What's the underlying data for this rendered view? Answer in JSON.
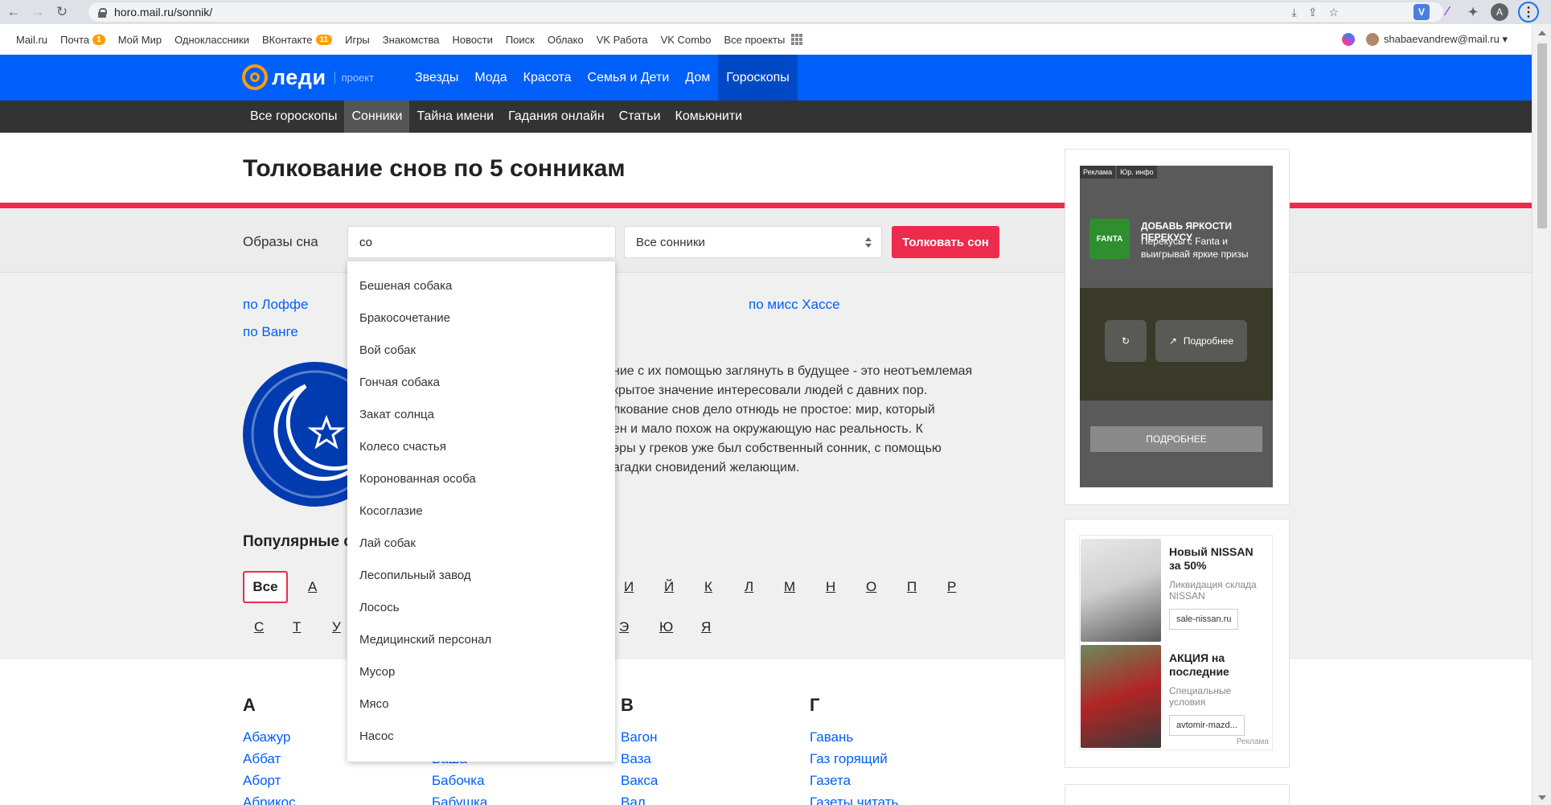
{
  "browser": {
    "url": "horo.mail.ru/sonnik/"
  },
  "portal": {
    "links": [
      {
        "label": "Mail.ru",
        "badge": ""
      },
      {
        "label": "Почта",
        "badge": "1"
      },
      {
        "label": "Мой Мир",
        "badge": ""
      },
      {
        "label": "Одноклассники",
        "badge": ""
      },
      {
        "label": "ВКонтакте",
        "badge": "11"
      },
      {
        "label": "Игры",
        "badge": ""
      },
      {
        "label": "Знакомства",
        "badge": ""
      },
      {
        "label": "Новости",
        "badge": ""
      },
      {
        "label": "Поиск",
        "badge": ""
      },
      {
        "label": "Облако",
        "badge": ""
      },
      {
        "label": "VK Работа",
        "badge": ""
      },
      {
        "label": "VK Combo",
        "badge": ""
      },
      {
        "label": "Все проекты",
        "badge": ""
      }
    ],
    "user": "shabaevandrew@mail.ru ▾"
  },
  "lady": {
    "logo": "леди",
    "project": "проект",
    "nav": [
      "Звезды",
      "Мода",
      "Красота",
      "Семья и Дети",
      "Дом",
      "Гороскопы"
    ],
    "active_nav": "Гороскопы"
  },
  "subnav": {
    "items": [
      "Все гороскопы",
      "Сонники",
      "Тайна имени",
      "Гадания онлайн",
      "Статьи",
      "Комьюнити"
    ],
    "active": "Сонники"
  },
  "page": {
    "title": "Толкование снов по 5 сонникам"
  },
  "search": {
    "label": "Образы сна",
    "value": "со",
    "select_value": "Все сонники",
    "button": "Толковать сон"
  },
  "sonnik_links": {
    "loff": "по Лоффе",
    "vanga": "по Ванге",
    "hasse": "по мисс Хассе"
  },
  "intro_lines": [
    "ние с их помощью заглянуть в будущее - это неотъемлемая",
    "крытое значение интересовали людей с давних пор.",
    "лкование снов дело отнюдь не простое: мир, который",
    "ен и мало похож на окружающую нас реальность. К",
    " эры у греков уже был собственный сонник, с помощью",
    "агадки сновидений желающим."
  ],
  "popular": {
    "title": "Популярные с",
    "all": "Все",
    "row1": [
      "А",
      "И",
      "Й",
      "К",
      "Л",
      "М",
      "Н",
      "О",
      "П",
      "Р"
    ],
    "row2": [
      "С",
      "Т",
      "У",
      "Э",
      "Ю",
      "Я"
    ]
  },
  "columns": [
    {
      "head": "А",
      "items": [
        "Абажур",
        "Аббат",
        "Аборт",
        "Абрикос"
      ]
    },
    {
      "head": "",
      "items": [
        "Ваша",
        "Бабочка",
        "Бабушка"
      ]
    },
    {
      "head": "В",
      "items": [
        "Вагон",
        "Ваза",
        "Вакса",
        "Вал"
      ]
    },
    {
      "head": "Г",
      "items": [
        "Гавань",
        "Газ горящий",
        "Газета",
        "Газеты читать"
      ]
    }
  ],
  "dropdown": [
    "Бешеная собака",
    "Бракосочетание",
    "Вой собак",
    "Гончая собака",
    "Закат солнца",
    "Колесо счастья",
    "Коронованная особа",
    "Косоглазие",
    "Лай собак",
    "Лесопильный завод",
    "Лосось",
    "Медицинский персонал",
    "Мусор",
    "Мясо",
    "Насос"
  ],
  "ad1": {
    "tags": [
      "Реклама",
      "Юр. инфо"
    ],
    "brand": "FANTA",
    "title": "ДОБАВЬ ЯРКОСТИ ПЕРЕКУСУ",
    "subtitle": "Перекусы с Fanta и выигрывай яркие призы",
    "details": "Подробнее",
    "more": "ПОДРОБНЕЕ"
  },
  "ad2": {
    "items": [
      {
        "title": "Новый NISSAN за 50%",
        "sub": "Ликвидация склада NISSAN",
        "btn": "sale-nissan.ru"
      },
      {
        "title": "АКЦИЯ на последние",
        "sub": "Специальные условия",
        "btn": "avtomir-mazd..."
      }
    ],
    "label": "Реклама"
  },
  "colors": {
    "brand_blue": "#005ff9",
    "accent_red": "#ed2b4c",
    "dark_nav": "#333333"
  }
}
